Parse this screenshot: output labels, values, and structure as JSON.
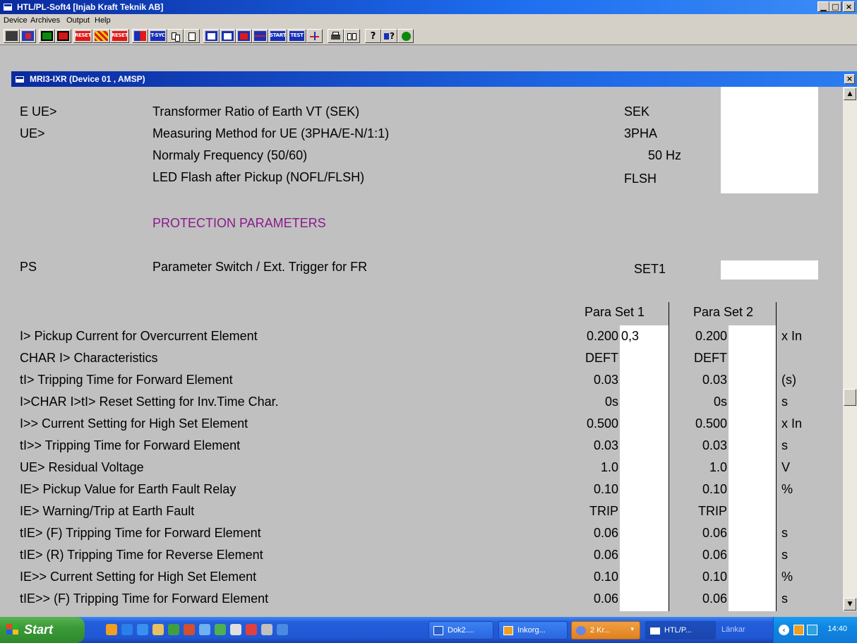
{
  "window": {
    "title": "HTL/PL-Soft4 [Injab Kraft Teknik AB]",
    "min": "▁",
    "max": "□",
    "close": "×"
  },
  "menu": [
    "Device",
    "Archives",
    "Output",
    "Help"
  ],
  "toolbar": {
    "reset1": "RESET",
    "reset2": "RESET",
    "tsyc": "T-SYC",
    "start": "START",
    "test": "TEST"
  },
  "child": {
    "title": "MRI3-IXR (Device 01 , AMSP)",
    "close": "×"
  },
  "settings": [
    {
      "code": "E UE>",
      "desc": "Transformer Ratio of Earth VT (SEK)",
      "value": "SEK"
    },
    {
      "code": "UE>",
      "desc": "Measuring Method for UE (3PHA/E-N/1:1)",
      "value": "3PHA"
    },
    {
      "code": "",
      "desc": "Normaly Frequency (50/60)",
      "value": "50 Hz"
    },
    {
      "code": "",
      "desc": "LED Flash after Pickup (NOFL/FLSH)",
      "value": "FLSH"
    }
  ],
  "section_title": "PROTECTION PARAMETERS",
  "ps": {
    "code": "PS",
    "desc": "Parameter Switch / Ext. Trigger for FR",
    "value": "SET1"
  },
  "headers": {
    "set1": "Para Set 1",
    "set2": "Para Set 2"
  },
  "params": [
    {
      "desc": "I> Pickup Current for Overcurrent Element",
      "v1": "0.200",
      "edit1": "0,3",
      "v2": "0.200",
      "unit": "x In"
    },
    {
      "desc": "CHAR I> Characteristics",
      "v1": "DEFT",
      "edit1": "",
      "v2": "DEFT",
      "unit": ""
    },
    {
      "desc": "tI> Tripping Time for Forward Element",
      "v1": "0.03",
      "edit1": "",
      "v2": "0.03",
      "unit": "(s)"
    },
    {
      "desc": "I>CHAR I>tI> Reset Setting for Inv.Time Char.",
      "v1": "0s",
      "edit1": "",
      "v2": "0s",
      "unit": "s"
    },
    {
      "desc": "I>> Current Setting for High Set Element",
      "v1": "0.500",
      "edit1": "",
      "v2": "0.500",
      "unit": "x In"
    },
    {
      "desc": "tI>> Tripping Time for Forward Element",
      "v1": "0.03",
      "edit1": "",
      "v2": "0.03",
      "unit": "s"
    },
    {
      "desc": "UE> Residual Voltage",
      "v1": "1.0",
      "edit1": "",
      "v2": "1.0",
      "unit": "V"
    },
    {
      "desc": "IE> Pickup Value for Earth Fault Relay",
      "v1": "0.10",
      "edit1": "",
      "v2": "0.10",
      "unit": "%"
    },
    {
      "desc": "IE> Warning/Trip at Earth Fault",
      "v1": "TRIP",
      "edit1": "",
      "v2": "TRIP",
      "unit": ""
    },
    {
      "desc": "tIE> (F) Tripping Time for Forward Element",
      "v1": "0.06",
      "edit1": "",
      "v2": "0.06",
      "unit": "s"
    },
    {
      "desc": "tIE> (R) Tripping Time for Reverse Element",
      "v1": "0.06",
      "edit1": "",
      "v2": "0.06",
      "unit": "s"
    },
    {
      "desc": "IE>> Current Setting for High Set Element",
      "v1": "0.10",
      "edit1": "",
      "v2": "0.10",
      "unit": "%"
    },
    {
      "desc": "tIE>> (F) Tripping Time for Forward Element",
      "v1": "0.06",
      "edit1": "",
      "v2": "0.06",
      "unit": "s"
    }
  ],
  "taskbar": {
    "start": "Start",
    "tasks": [
      {
        "label": "Dok2....",
        "icon_color": "#2b5fc9"
      },
      {
        "label": "Inkorg...",
        "icon_color": "#f0a020"
      },
      {
        "label": "2 Kr...",
        "icon_color": "#6b86e0"
      },
      {
        "label": "HTL/P...",
        "icon_color": "#ffffff"
      }
    ],
    "links": "Länkar",
    "clock": "14:40"
  }
}
